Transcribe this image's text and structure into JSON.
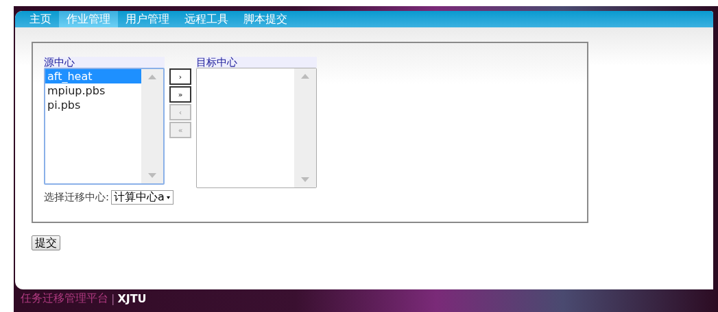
{
  "nav": [
    {
      "label": "主页",
      "selected": false
    },
    {
      "label": "作业管理",
      "selected": true
    },
    {
      "label": "用户管理",
      "selected": false
    },
    {
      "label": "远程工具",
      "selected": false
    },
    {
      "label": "脚本提交",
      "selected": false
    }
  ],
  "source": {
    "label": "源中心",
    "items": [
      {
        "label": "aft_heat",
        "selected": true
      },
      {
        "label": "mpiup.pbs",
        "selected": false
      },
      {
        "label": "pi.pbs",
        "selected": false
      }
    ]
  },
  "move_buttons": [
    {
      "label": "›",
      "disabled": false
    },
    {
      "label": "»",
      "disabled": false
    },
    {
      "label": "‹",
      "disabled": true
    },
    {
      "label": "«",
      "disabled": true
    }
  ],
  "target": {
    "label": "目标中心"
  },
  "migrate": {
    "label": "选择迁移中心:",
    "value": "计算中心a"
  },
  "submit": "提交",
  "footer": {
    "title": "任务迁移管理平台",
    "separator": "|",
    "org": "XJTU"
  }
}
